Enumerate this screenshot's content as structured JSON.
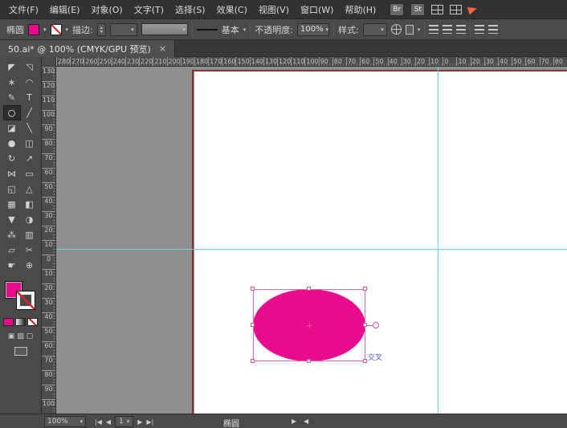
{
  "menu_bar": {
    "items": [
      "文件(F)",
      "编辑(E)",
      "对象(O)",
      "文字(T)",
      "选择(S)",
      "效果(C)",
      "视图(V)",
      "窗口(W)",
      "帮助(H)"
    ],
    "bridge_label": "Br",
    "stock_label": "St"
  },
  "control_bar": {
    "selection_type_label": "椭圆",
    "stroke_label": "描边:",
    "brush_definition_label": "基本",
    "opacity_label": "不透明度:",
    "opacity_value": "100%",
    "style_label": "样式:",
    "fill_color": "#e90b8d"
  },
  "document_tab": {
    "title": "50.ai*  @  100% (CMYK/GPU 预览)",
    "close_glyph": "×"
  },
  "tools": [
    {
      "name": "selection-tool",
      "glyph": "◤"
    },
    {
      "name": "direct-selection-tool",
      "glyph": "◹"
    },
    {
      "name": "magic-wand-tool",
      "glyph": "∗"
    },
    {
      "name": "lasso-tool",
      "glyph": "◠"
    },
    {
      "name": "pen-tool",
      "glyph": "✎"
    },
    {
      "name": "type-tool",
      "glyph": "T"
    },
    {
      "name": "ellipse-tool",
      "glyph": "○",
      "selected": true
    },
    {
      "name": "line-segment-tool",
      "glyph": "╱"
    },
    {
      "name": "paintbrush-tool",
      "glyph": "◪"
    },
    {
      "name": "pencil-tool",
      "glyph": "╲"
    },
    {
      "name": "blob-brush-tool",
      "glyph": "●"
    },
    {
      "name": "eraser-tool",
      "glyph": "◫"
    },
    {
      "name": "rotate-tool",
      "glyph": "↻"
    },
    {
      "name": "scale-tool",
      "glyph": "↗"
    },
    {
      "name": "width-tool",
      "glyph": "⋈"
    },
    {
      "name": "free-transform-tool",
      "glyph": "▭"
    },
    {
      "name": "shape-builder-tool",
      "glyph": "◱"
    },
    {
      "name": "perspective-grid-tool",
      "glyph": "△"
    },
    {
      "name": "mesh-tool",
      "glyph": "▦"
    },
    {
      "name": "gradient-tool",
      "glyph": "◧"
    },
    {
      "name": "eyedropper-tool",
      "glyph": "▼"
    },
    {
      "name": "blend-tool",
      "glyph": "◑"
    },
    {
      "name": "symbol-sprayer-tool",
      "glyph": "⁂"
    },
    {
      "name": "column-graph-tool",
      "glyph": "▥"
    },
    {
      "name": "artboard-tool",
      "glyph": "▱"
    },
    {
      "name": "slice-tool",
      "glyph": "✂"
    },
    {
      "name": "hand-tool",
      "glyph": "☛"
    },
    {
      "name": "zoom-tool",
      "glyph": "⊕"
    }
  ],
  "rulers": {
    "horizontal_labels": [
      "280",
      "270",
      "260",
      "250",
      "240",
      "230",
      "220",
      "210",
      "200",
      "190",
      "180",
      "170",
      "160",
      "150",
      "140",
      "130",
      "120",
      "110",
      "100",
      "90",
      "80",
      "70",
      "60",
      "50",
      "40",
      "30",
      "20",
      "10",
      "0",
      "10",
      "20",
      "30",
      "40",
      "50",
      "60",
      "70",
      "80"
    ],
    "vertical_labels": [
      "130",
      "120",
      "110",
      "100",
      "90",
      "80",
      "70",
      "60",
      "50",
      "40",
      "30",
      "20",
      "10",
      "0",
      "10",
      "20",
      "30",
      "40",
      "50",
      "60",
      "70",
      "80",
      "90",
      "100"
    ]
  },
  "canvas": {
    "guide_color": "#61dcdc",
    "artboard_edge_color": "#8b3232",
    "selection_color": "#d9509b",
    "ellipse_fill": "#e90b8d",
    "smart_guide_label": "交叉",
    "smart_guide_color": "#4f55d2"
  },
  "status_bar": {
    "zoom": "100%",
    "zoom_arrow": "▾",
    "nav_first": "|◀",
    "nav_prev": "◀",
    "artboard_number": "1",
    "nav_next": "▶",
    "nav_last": "▶|",
    "tool_label": "椭圆",
    "panel_arrow_right": "▶",
    "panel_arrow_left": "◀"
  }
}
